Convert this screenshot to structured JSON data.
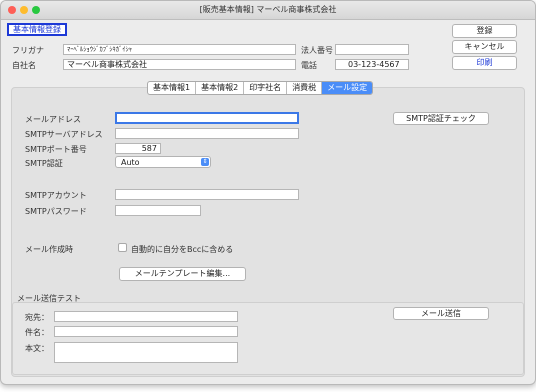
{
  "window": {
    "title": "[販売基本情報] マーベル商事株式会社"
  },
  "header": {
    "section_label": "基本情報登録",
    "furigana_label": "フリガナ",
    "furigana_value": "ﾏｰﾍﾞﾙｼｮｳｼﾞｶﾌﾞｼｷｶﾞｲｼｬ",
    "company_label": "自社名",
    "company_value": "マーベル商事株式会社",
    "corp_number_label": "法人番号",
    "corp_number_value": "",
    "phone_label": "電話",
    "phone_value": "03-123-4567"
  },
  "actions": {
    "register": "登録",
    "cancel": "キャンセル",
    "print": "印刷"
  },
  "tabs": [
    {
      "label": "基本情報1"
    },
    {
      "label": "基本情報2"
    },
    {
      "label": "印字社名"
    },
    {
      "label": "消費税"
    },
    {
      "label": "メール設定"
    }
  ],
  "mail": {
    "address_label": "メールアドレス",
    "address_value": "",
    "smtp_server_label": "SMTPサーバアドレス",
    "smtp_server_value": "",
    "smtp_port_label": "SMTPポート番号",
    "smtp_port_value": "587",
    "smtp_auth_label": "SMTP認証",
    "smtp_auth_value": "Auto",
    "smtp_check_button": "SMTP認証チェック",
    "smtp_account_label": "SMTPアカウント",
    "smtp_account_value": "",
    "smtp_password_label": "SMTPパスワード",
    "smtp_password_value": "",
    "compose_label": "メール作成時",
    "auto_bcc_label": "自動的に自分をBccに含める",
    "template_button": "メールテンプレート編集..."
  },
  "test": {
    "group_label": "メール送信テスト",
    "to_label": "宛先：",
    "to_value": "",
    "subject_label": "件名：",
    "subject_value": "",
    "body_label": "本文：",
    "body_value": "",
    "send_button": "メール送信"
  },
  "colors": {
    "accent": "#4a8df8",
    "focus_ring": "#3b78e7",
    "section_border": "#1d39d6"
  }
}
